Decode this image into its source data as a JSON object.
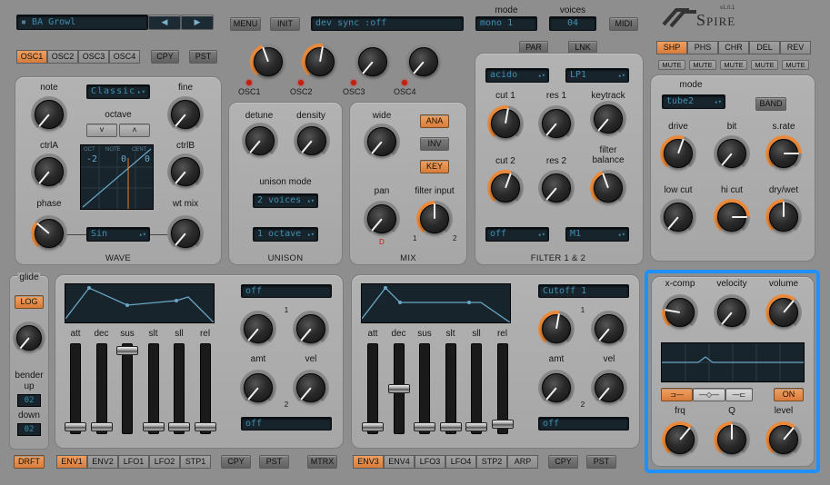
{
  "header": {
    "preset_name": "BA Growl",
    "menu": "MENU",
    "init": "INIT",
    "sync_display": "dev sync        :off",
    "mode_label": "mode",
    "mode_value": "mono 1",
    "voices_label": "voices",
    "voices_value": "04",
    "midi": "MIDI",
    "logo": "Spire",
    "version": "v1.0.1"
  },
  "osc_tabs": [
    "OSC1",
    "OSC2",
    "OSC3",
    "OSC4"
  ],
  "copy": "CPY",
  "paste": "PST",
  "osc_leds": [
    "OSC1",
    "OSC2",
    "OSC3",
    "OSC4"
  ],
  "wave_section": {
    "note": "note",
    "fine": "fine",
    "octave": "octave",
    "wt_display": "Classic",
    "ctrlA": "ctrlA",
    "ctrlB": "ctrlB",
    "phase": "phase",
    "wt_mix": "wt mix",
    "wave_select": "Sin",
    "title": "WAVE",
    "oct_down": "˅",
    "oct_up": "˄",
    "scope_headers": [
      "OCT",
      "NOTE",
      "CENT"
    ],
    "scope_values": [
      "-2",
      "0",
      "0"
    ]
  },
  "unison": {
    "detune": "detune",
    "density": "density",
    "mode_label": "unison mode",
    "voices": "2 voices",
    "octave": "1 octave",
    "title": "UNISON"
  },
  "mix": {
    "wide": "wide",
    "ana": "ANA",
    "inv": "INV",
    "key": "KEY",
    "pan": "pan",
    "filter_input": "filter input",
    "fi_1": "1",
    "fi_2": "2",
    "pan_mark": "D",
    "title": "MIX"
  },
  "filter": {
    "par": "PAR",
    "lnk": "LNK",
    "type1": "acido",
    "type2": "LP1",
    "cut1": "cut 1",
    "res1": "res 1",
    "keytrack": "keytrack",
    "cut2": "cut 2",
    "res2": "res 2",
    "balance": "filter\nbalance",
    "sel1": "off",
    "sel2": "M1",
    "title": "FILTER 1 & 2"
  },
  "fx_tabs": [
    "SHP",
    "PHS",
    "CHR",
    "DEL",
    "REV"
  ],
  "mute": "MUTE",
  "shaper": {
    "mode": "mode",
    "mode_value": "tube2",
    "band": "BAND",
    "drive": "drive",
    "bit": "bit",
    "srate": "s.rate",
    "lowcut": "low cut",
    "hicut": "hi cut",
    "drywet": "dry/wet"
  },
  "glide": {
    "title": "glide",
    "log": "LOG",
    "bender": "bender",
    "up": "up",
    "up_value": "02",
    "down": "down",
    "down_value": "02"
  },
  "env1": {
    "labels": [
      "att",
      "dec",
      "sus",
      "slt",
      "sll",
      "rel"
    ],
    "dest1": "off",
    "dest2": "off",
    "amt": "amt",
    "vel": "vel",
    "n1": "1",
    "n2": "2"
  },
  "env2": {
    "labels": [
      "att",
      "dec",
      "sus",
      "slt",
      "sll",
      "rel"
    ],
    "dest1": "Cutoff 1",
    "dest2": "off",
    "amt": "amt",
    "vel": "vel",
    "n1": "1",
    "n2": "2"
  },
  "bottom_tabs_left": [
    "ENV1",
    "ENV2",
    "LFO1",
    "LFO2",
    "STP1"
  ],
  "bottom_tabs_right": [
    "ENV3",
    "ENV4",
    "LFO3",
    "LFO4",
    "STP2",
    "ARP"
  ],
  "drft": "DRFT",
  "mtrx": "MTRX",
  "eq": {
    "xcomp": "x-comp",
    "velocity": "velocity",
    "volume": "volume",
    "on": "ON",
    "frq": "frq",
    "q": "Q",
    "level": "level",
    "shape1": "⊐—",
    "shape2": "—◇—",
    "shape3": "—⊏"
  },
  "colors": {
    "accent": "#e98a3c",
    "highlight": "#1e90ff",
    "lcd_text": "#3f8fb0"
  }
}
